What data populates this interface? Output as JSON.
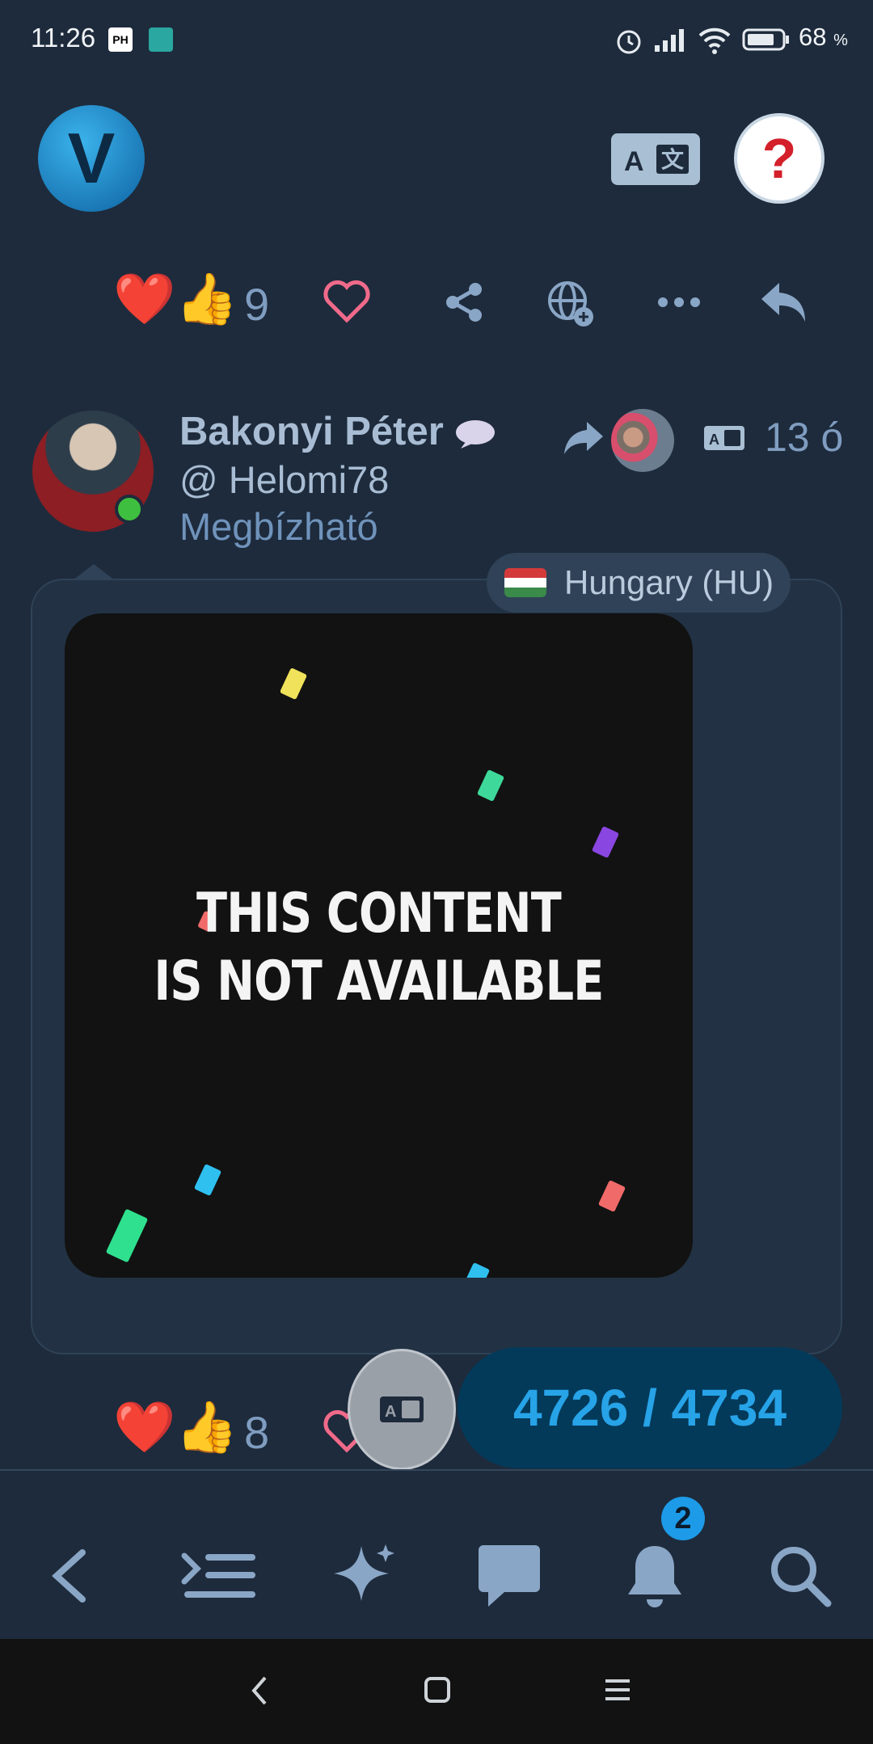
{
  "status_bar": {
    "time": "11:26",
    "battery_percent": "68",
    "battery_unit": "%"
  },
  "top_bar": {
    "logo_letter": "V",
    "help_glyph": "?"
  },
  "first_post_footer": {
    "reaction_emojis": "❤️👍",
    "reaction_count": "9"
  },
  "post": {
    "author_name": "Bakonyi Péter",
    "author_handle": "@ Helomi78",
    "author_status": "Megbízható",
    "time_ago": "13 ó",
    "country_label": "Hungary (HU)",
    "media_line1": "THIS CONTENT",
    "media_line2": "IS NOT AVAILABLE",
    "reaction_emojis": "❤️👍",
    "reaction_count": "8"
  },
  "progress": {
    "label": "4726 / 4734"
  },
  "bottom_nav": {
    "notification_badge": "2"
  },
  "colors": {
    "accent": "#27a3e8",
    "background": "#1e2b3c",
    "card": "#223244",
    "heart": "#f06a8a",
    "online": "#3fbf3f"
  },
  "icons": [
    "alarm-icon",
    "signal-icon",
    "wifi-icon",
    "battery-icon",
    "translate-icon",
    "heart-outline-icon",
    "share-icon",
    "globe-add-icon",
    "more-icon",
    "reply-icon",
    "speech-bubble-icon",
    "repost-icon",
    "back-icon",
    "thread-icon",
    "sparkle-icon",
    "chat-icon",
    "bell-icon",
    "search-icon"
  ]
}
